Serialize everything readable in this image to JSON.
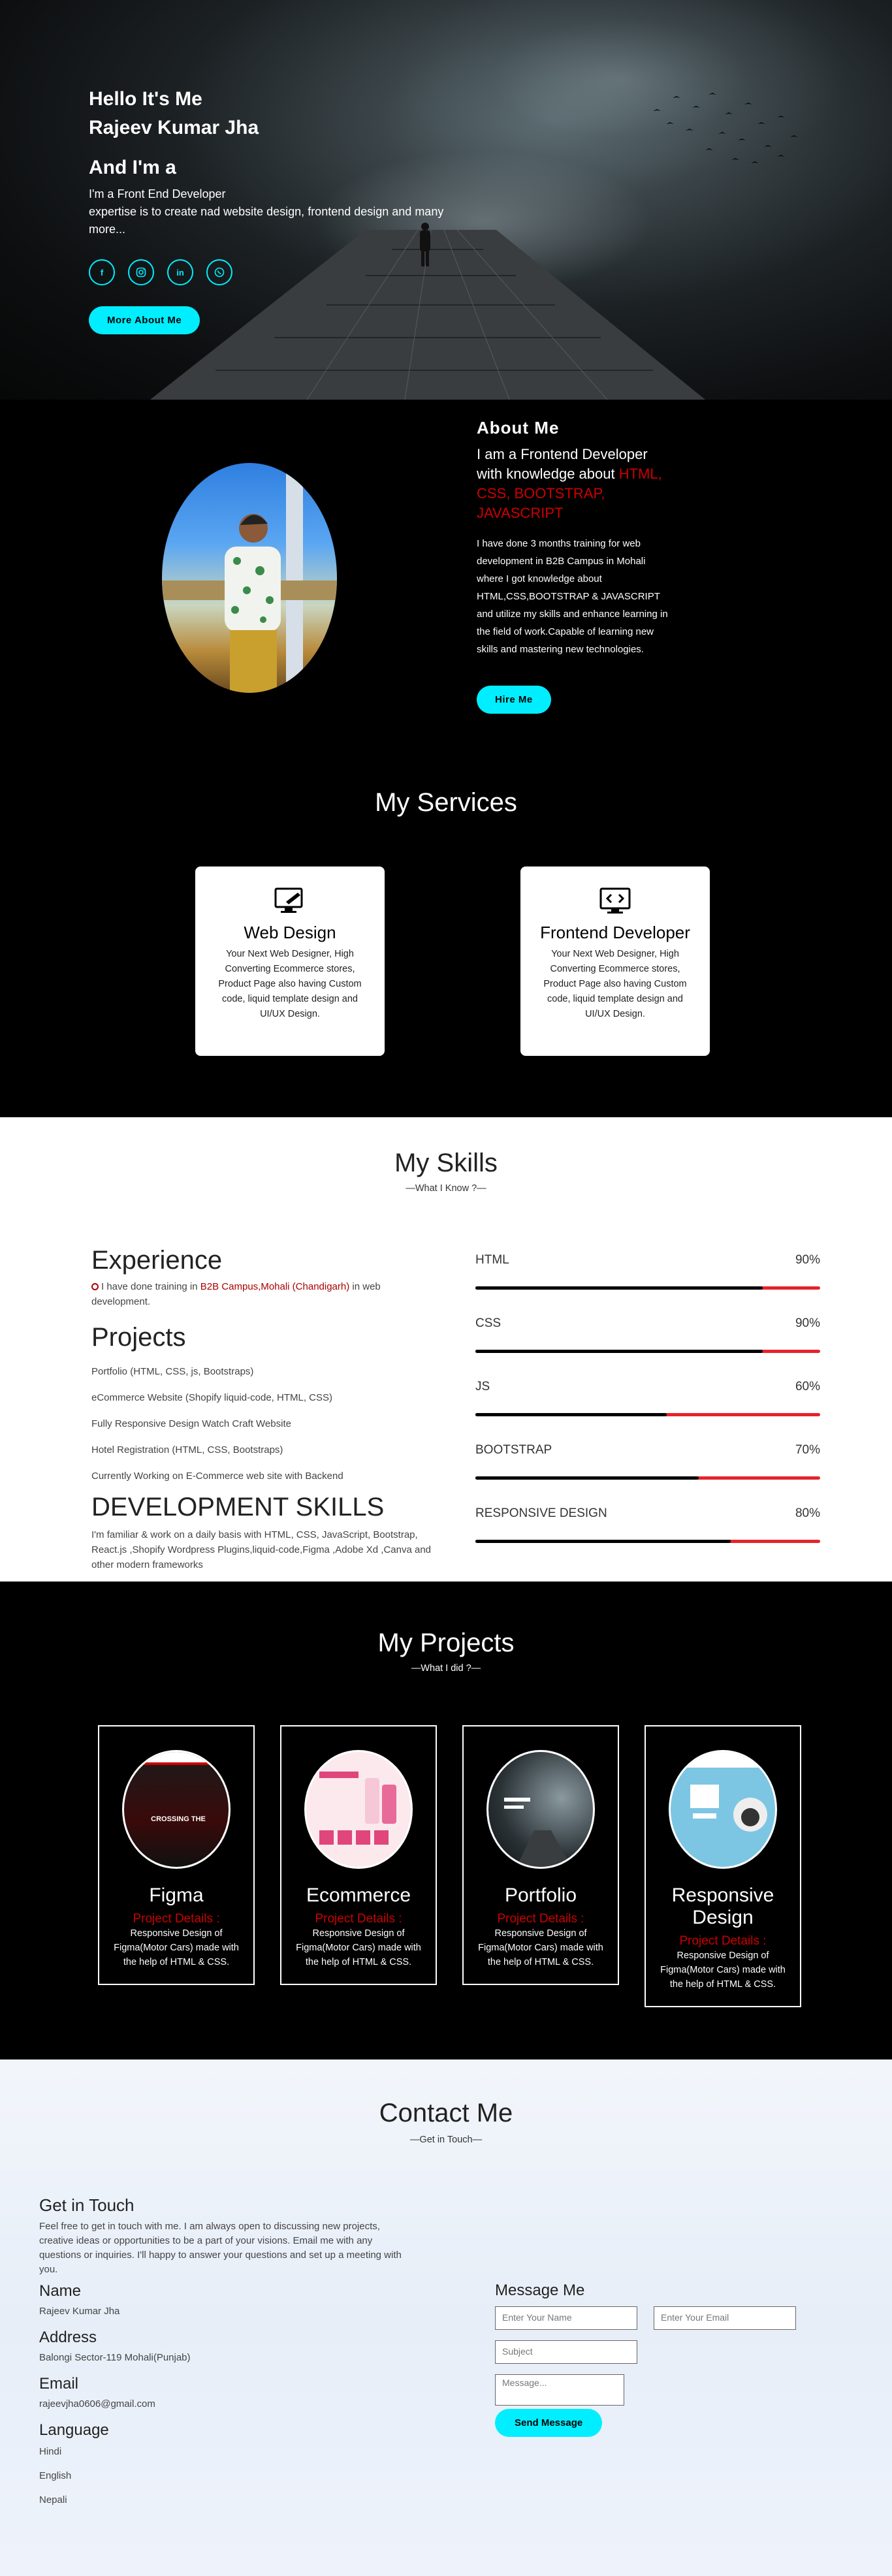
{
  "hero": {
    "greeting_line1": "Hello It's Me",
    "greeting_line2": "Rajeev Kumar Jha",
    "and_im": "And I'm a",
    "subtitle_line1": "I'm a Front End Developer",
    "subtitle_line2": "expertise is to create nad website design, frontend design and many more...",
    "social_icons": [
      "facebook-icon",
      "instagram-icon",
      "linkedin-icon",
      "whatsapp-icon"
    ],
    "cta_label": "More About Me"
  },
  "about": {
    "heading": "About Me",
    "lead_prefix": "I am a Frontend Developer with knowledge about ",
    "lead_skills": "HTML, CSS, BOOTSTRAP, JAVASCRIPT",
    "body": "I have done 3 months training for web development in B2B Campus in Mohali where I got knowledge about HTML,CSS,BOOTSTRAP & JAVASCRIPT and utilize my skills and enhance learning in the field of work.Capable of learning new skills and mastering new technologies.",
    "cta_label": "Hire Me"
  },
  "services": {
    "heading": "My Services",
    "items": [
      {
        "icon": "monitor-pen-icon",
        "title": "Web Design",
        "text": "Your Next Web Designer, High Converting Ecommerce stores, Product Page also having Custom code, liquid template design and UI/UX Design."
      },
      {
        "icon": "code-monitor-icon",
        "title": "Frontend Developer",
        "text": "Your Next Web Designer, High Converting Ecommerce stores, Product Page also having Custom code, liquid template design and UI/UX Design."
      }
    ]
  },
  "skills": {
    "heading": "My Skills",
    "tagline": "—What I Know ?—",
    "experience_heading": "Experience",
    "experience_prefix": "I have done training in ",
    "experience_place": "B2B Campus,Mohali (Chandigarh)",
    "experience_suffix": " in web development.",
    "projects_heading": "Projects",
    "projects": [
      "Portfolio (HTML, CSS, js, Bootstraps)",
      "eCommerce Website (Shopify liquid-code, HTML, CSS)",
      "Fully Responsive Design Watch Craft Website",
      "Hotel Registration (HTML, CSS, Bootstraps)",
      "Currently Working on E-Commerce web site with Backend"
    ],
    "dev_heading": "DEVELOPMENT SKILLS",
    "dev_text": "I'm familiar & work on a daily basis with HTML, CSS, JavaScript, Bootstrap, React.js ,Shopify Wordpress Plugins,liquid-code,Figma ,Adobe Xd ,Canva and other modern frameworks",
    "bars": [
      {
        "label": "HTML",
        "percent_label": "90%",
        "value": 90
      },
      {
        "label": "CSS",
        "percent_label": "90%",
        "value": 90
      },
      {
        "label": "JS",
        "percent_label": "60%",
        "value": 60
      },
      {
        "label": "BOOTSTRAP",
        "percent_label": "70%",
        "value": 70
      },
      {
        "label": "RESPONSIVE DESIGN",
        "percent_label": "80%",
        "value": 80
      }
    ]
  },
  "projects": {
    "heading": "My Projects",
    "tagline": "—What I did ?—",
    "items": [
      {
        "title": "Figma",
        "details_label": "Project Details :",
        "text": "Responsive Design of Figma(Motor Cars) made with the help of HTML & CSS."
      },
      {
        "title": "Ecommerce",
        "details_label": "Project Details :",
        "text": "Responsive Design of Figma(Motor Cars) made with the help of HTML & CSS."
      },
      {
        "title": "Portfolio",
        "details_label": "Project Details :",
        "text": "Responsive Design of Figma(Motor Cars) made with the help of HTML & CSS."
      },
      {
        "title": "Responsive Design",
        "details_label": "Project Details :",
        "text": "Responsive Design of Figma(Motor Cars) made with the help of HTML & CSS."
      }
    ]
  },
  "contact": {
    "heading": "Contact Me",
    "tagline": "—Get in Touch—",
    "get_in_touch": "Get in Touch",
    "intro": "Feel free to get in touch with me. I am always open to discussing new projects, creative ideas or opportunities to be a part of your visions. Email me with any questions or inquiries. I'll happy to answer your questions and set up a meeting with you.",
    "name_label": "Name",
    "name_value": "Rajeev Kumar Jha",
    "address_label": "Address",
    "address_value": "Balongi Sector-119 Mohali(Punjab)",
    "email_label": "Email",
    "email_value": "rajeevjha0606@gmail.com",
    "language_label": "Language",
    "languages": [
      "Hindi",
      "English",
      "Nepali"
    ],
    "form_heading": "Message Me",
    "name_placeholder": "Enter Your Name",
    "email_placeholder": "Enter Your Email",
    "subject_placeholder": "Subject",
    "message_placeholder": "Message...",
    "send_label": "Send Message"
  },
  "colors": {
    "accent": "#00eeff",
    "highlight_red": "#cc0000",
    "bar_red": "#e4242c"
  }
}
